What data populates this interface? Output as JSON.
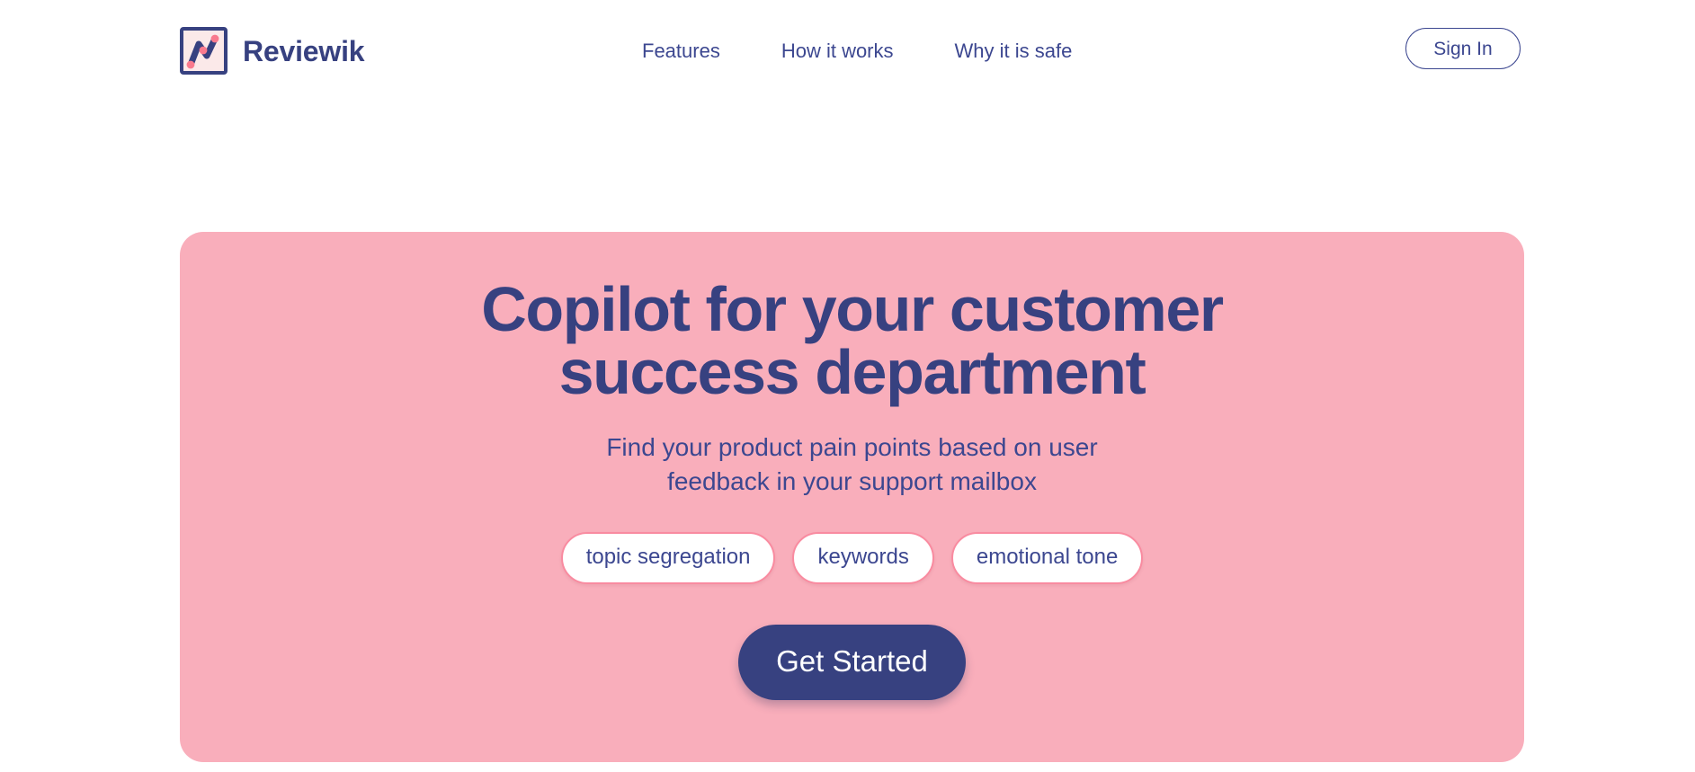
{
  "header": {
    "brand": {
      "name": "Reviewik",
      "logo_icon": "chart-zigzag-logo-icon"
    },
    "nav": [
      {
        "label": "Features"
      },
      {
        "label": "How it works"
      },
      {
        "label": "Why it is safe"
      }
    ],
    "signin_label": "Sign In"
  },
  "hero": {
    "title_line1": "Copilot for your customer",
    "title_line2": "success department",
    "subtitle_line1": "Find your product pain points based on user",
    "subtitle_line2": "feedback in your support mailbox",
    "tags": [
      {
        "label": "topic segregation"
      },
      {
        "label": "keywords"
      },
      {
        "label": "emotional tone"
      }
    ],
    "cta_label": "Get Started"
  },
  "colors": {
    "navy": "#374180",
    "navy_text": "#3c4790",
    "hero_pink": "#f9aebb",
    "pill_border": "#f98ba0",
    "logo_fill": "#fbe9e9",
    "dot_coral": "#f97a8e",
    "page_background": "#ffffff"
  }
}
